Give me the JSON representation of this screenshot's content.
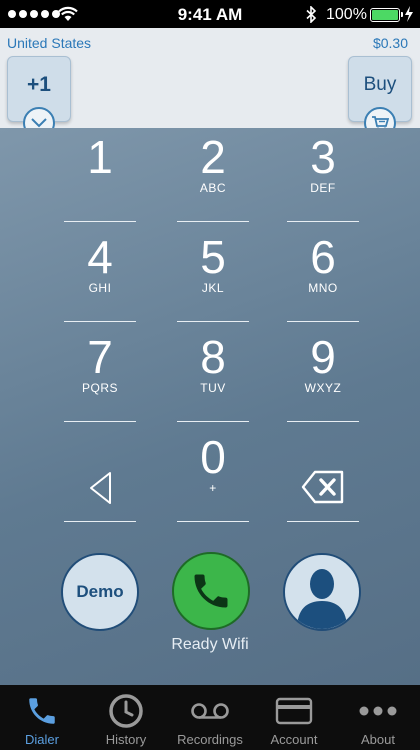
{
  "status_bar": {
    "time": "9:41 AM",
    "battery_percent": "100%"
  },
  "top_panel": {
    "country": "United States",
    "rate": "$0.30",
    "country_code": "+1",
    "buy_label": "Buy"
  },
  "keypad": {
    "keys": [
      {
        "digit": "1",
        "letters": ""
      },
      {
        "digit": "2",
        "letters": "ABC"
      },
      {
        "digit": "3",
        "letters": "DEF"
      },
      {
        "digit": "4",
        "letters": "GHI"
      },
      {
        "digit": "5",
        "letters": "JKL"
      },
      {
        "digit": "6",
        "letters": "MNO"
      },
      {
        "digit": "7",
        "letters": "PQRS"
      },
      {
        "digit": "8",
        "letters": "TUV"
      },
      {
        "digit": "9",
        "letters": "WXYZ"
      },
      {
        "digit": "0",
        "letters": "+"
      }
    ]
  },
  "actions": {
    "demo_label": "Demo",
    "status_text": "Ready Wifi"
  },
  "tab_bar": {
    "tabs": [
      {
        "label": "Dialer",
        "icon": "phone-icon",
        "active": true
      },
      {
        "label": "History",
        "icon": "clock-icon",
        "active": false
      },
      {
        "label": "Recordings",
        "icon": "voicemail-icon",
        "active": false
      },
      {
        "label": "Account",
        "icon": "credit-card-icon",
        "active": false
      },
      {
        "label": "About",
        "icon": "more-icon",
        "active": false
      }
    ]
  },
  "colors": {
    "accent_blue": "#2b78b8",
    "call_green": "#3cb64a",
    "active_tab": "#5b9fe0",
    "battery_green": "#4cd964"
  }
}
